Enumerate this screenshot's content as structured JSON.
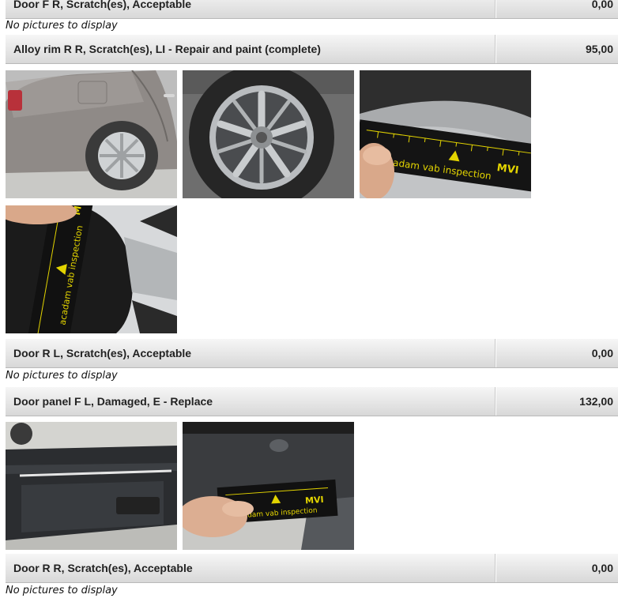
{
  "damage_items": [
    {
      "description": "Door F R, Scratch(es), Acceptable",
      "amount": "0,00"
    },
    {
      "description": "Alloy rim R R, Scratch(es), LI - Repair and paint (complete)",
      "amount": "95,00"
    },
    {
      "description": "Door R L, Scratch(es), Acceptable",
      "amount": "0,00"
    },
    {
      "description": "Door panel F L, Damaged, E - Replace",
      "amount": "132,00"
    },
    {
      "description": "Door R R, Scratch(es), Acceptable",
      "amount": "0,00"
    }
  ],
  "no_pictures_text": "No pictures to display",
  "ruler_text": "acadam vab inspection",
  "ruler_logo": "MVI"
}
